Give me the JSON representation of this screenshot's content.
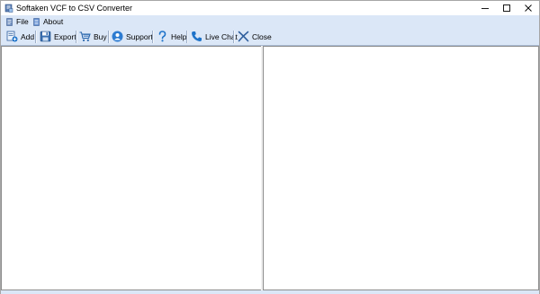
{
  "window": {
    "title": "Softaken VCF to CSV Converter"
  },
  "menu": {
    "items": [
      {
        "label": "File",
        "icon": "file-menu-icon"
      },
      {
        "label": "About",
        "icon": "about-menu-icon"
      }
    ]
  },
  "toolbar": {
    "add_label": "Add",
    "export_label": "Export",
    "buy_label": "Buy",
    "support_label": "Support",
    "help_label": "Help",
    "livechat_label": "Live Chat",
    "close_label": "Close"
  },
  "colors": {
    "menubar_bg": "#dbe7f7",
    "toolbar_bg": "#dbe7f7",
    "accent_blue": "#1e73c9"
  }
}
